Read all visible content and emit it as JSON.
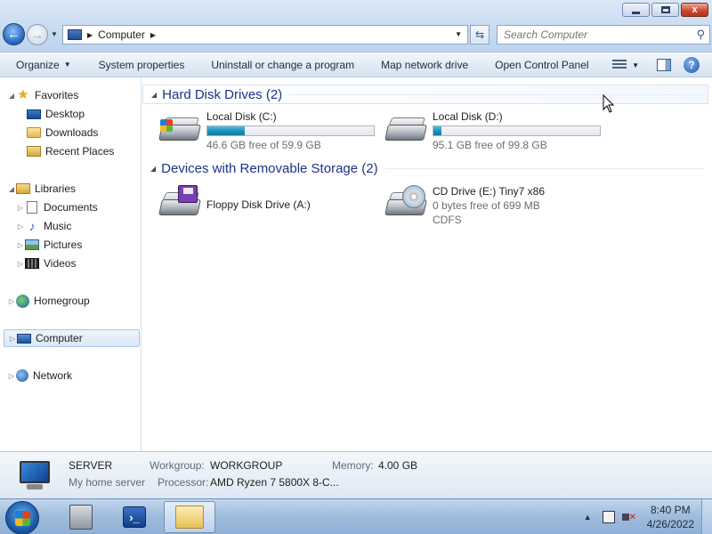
{
  "window": {
    "close_glyph": "x"
  },
  "nav": {
    "back_glyph": "←",
    "forward_glyph": "→",
    "breadcrumb": "Computer",
    "search_placeholder": "Search Computer"
  },
  "toolbar": {
    "organize": "Organize",
    "system_properties": "System properties",
    "uninstall": "Uninstall or change a program",
    "map_drive": "Map network drive",
    "control_panel": "Open Control Panel",
    "help": "?"
  },
  "sidebar": {
    "favorites": "Favorites",
    "desktop": "Desktop",
    "downloads": "Downloads",
    "recent_places": "Recent Places",
    "libraries": "Libraries",
    "documents": "Documents",
    "music": "Music",
    "pictures": "Pictures",
    "videos": "Videos",
    "homegroup": "Homegroup",
    "computer": "Computer",
    "network": "Network"
  },
  "groups": {
    "hdd_title": "Hard Disk Drives (2)",
    "removable_title": "Devices with Removable Storage (2)"
  },
  "drives": {
    "c": {
      "name": "Local Disk (C:)",
      "free": "46.6 GB free of 59.9 GB",
      "used_fraction": 0.222
    },
    "d": {
      "name": "Local Disk (D:)",
      "free": "95.1 GB free of 99.8 GB",
      "used_fraction": 0.047
    },
    "a": {
      "name": "Floppy Disk Drive (A:)"
    },
    "e": {
      "name": "CD Drive (E:) Tiny7 x86",
      "free": "0 bytes free of 699 MB",
      "fs": "CDFS"
    }
  },
  "details": {
    "name": "SERVER",
    "description": "My home server",
    "workgroup_label": "Workgroup:",
    "workgroup": "WORKGROUP",
    "memory_label": "Memory:",
    "memory": "4.00 GB",
    "processor_label": "Processor:",
    "processor": "AMD Ryzen 7 5800X 8-C..."
  },
  "taskbar": {
    "powershell_glyph": "›_",
    "time": "8:40 PM",
    "date": "4/26/2022"
  },
  "colors": {
    "accent": "#1e3287",
    "selection": "#dbe8f7",
    "bar_fill": "#1b8fb6"
  }
}
